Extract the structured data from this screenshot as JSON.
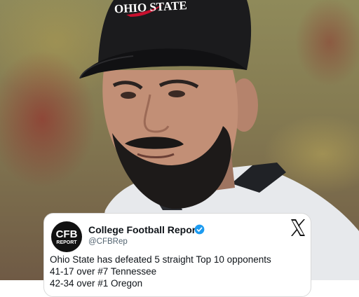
{
  "photo": {
    "cap_text": "OHIO STATE"
  },
  "tweet": {
    "logo_text_top": "CFB",
    "logo_text_bottom": "REPORT",
    "display_name": "College Football Report",
    "handle": "@CFBRep",
    "verified_icon": "verified-badge-icon",
    "platform_icon": "x-logo-icon",
    "lines": [
      "Ohio State has defeated 5 straight Top 10 opponents",
      "41-17 over #7 Tennessee",
      "42-34 over #1 Oregon"
    ]
  },
  "colors": {
    "verified_blue": "#1d9bf0",
    "cap_black": "#1b1b1d",
    "swoosh_red": "#c8102e"
  }
}
